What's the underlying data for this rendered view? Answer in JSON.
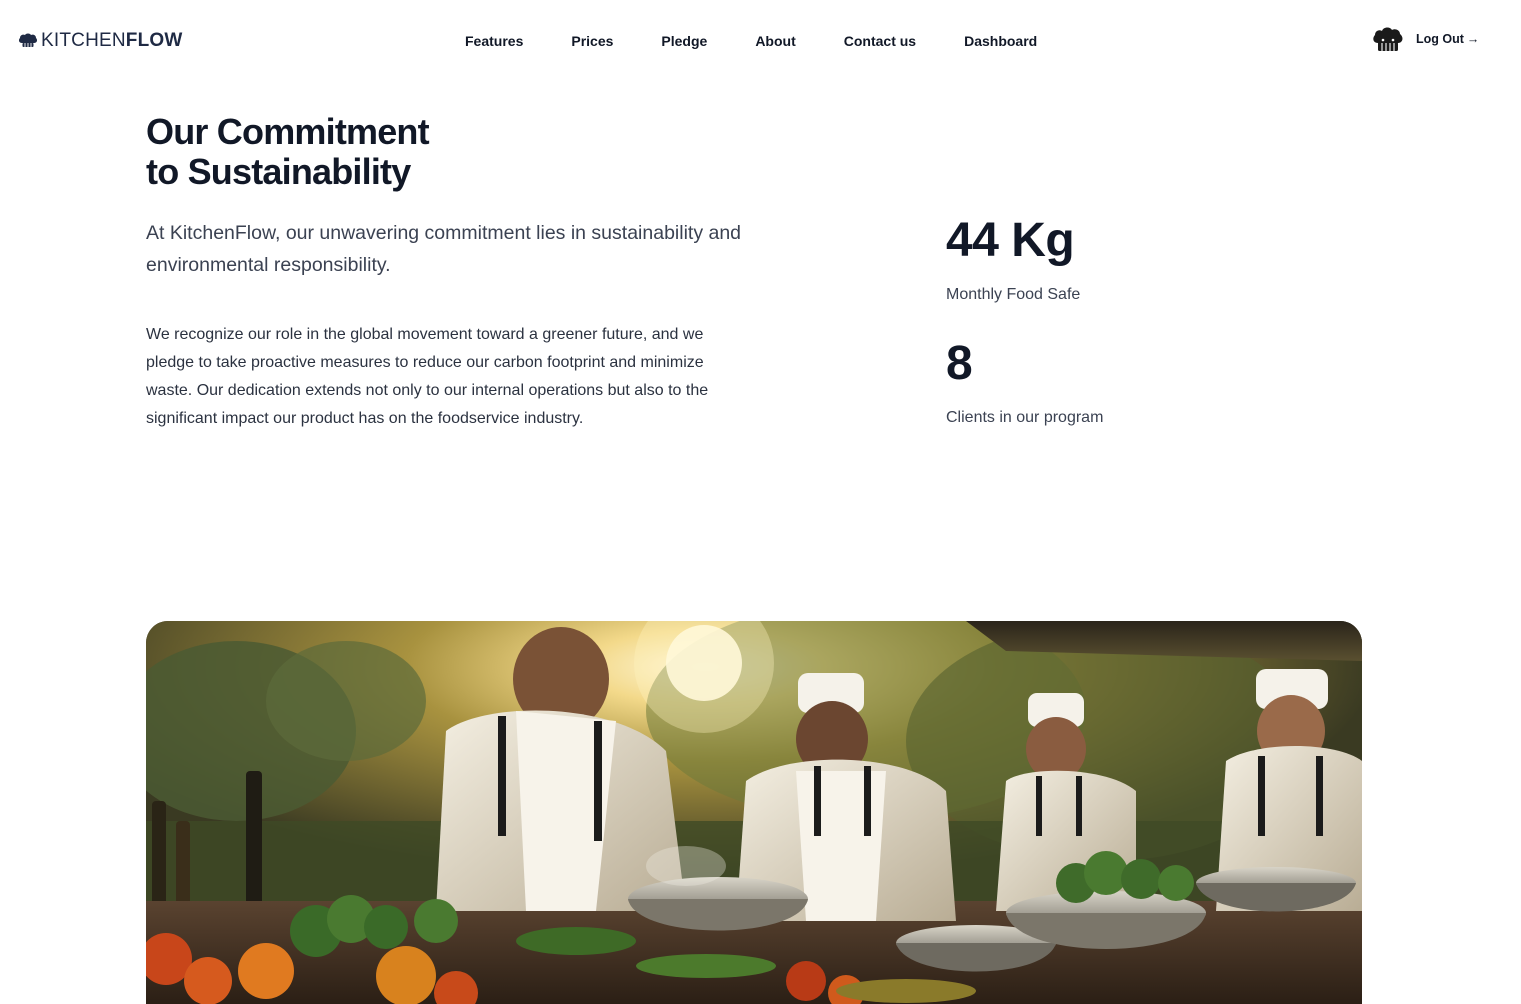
{
  "brand": {
    "name_light": "KITCHEN",
    "name_bold": "FLOW",
    "logo_icon": "chef-hat-icon"
  },
  "nav": {
    "items": [
      {
        "label": "Features"
      },
      {
        "label": "Prices"
      },
      {
        "label": "Pledge"
      },
      {
        "label": "About"
      },
      {
        "label": "Contact us"
      },
      {
        "label": "Dashboard"
      }
    ]
  },
  "user": {
    "avatar_icon": "chef-hat-avatar-icon",
    "logout_label": "Log Out",
    "logout_arrow": "→"
  },
  "section": {
    "title_line1": "Our Commitment",
    "title_line2": "to Sustainability",
    "lead": "At KitchenFlow, our unwavering commitment lies in sustainability and environmental responsibility.",
    "body": "We recognize our role in the global movement toward a greener future, and we pledge to take proactive measures to reduce our carbon footprint and minimize waste. Our dedication extends not only to our internal operations but also to the significant impact our product has on the foodservice industry."
  },
  "stats": [
    {
      "value": "44 Kg",
      "label": "Monthly Food Safe"
    },
    {
      "value": "8",
      "label": "Clients in our program"
    }
  ],
  "hero_image": {
    "subject": "chefs cooking vegetables outdoors at sunset"
  },
  "colors": {
    "text_primary": "#111827",
    "text_secondary": "#3b4252",
    "brand_navy": "#1f2a44",
    "background": "#ffffff"
  }
}
